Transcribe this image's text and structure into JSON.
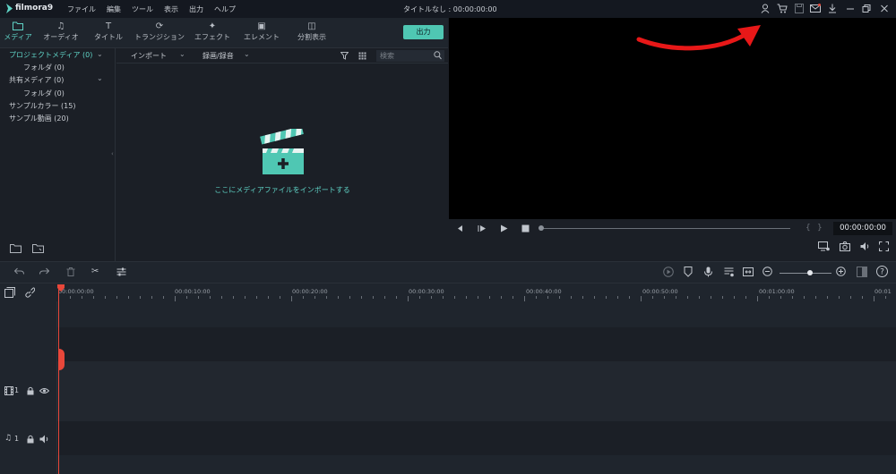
{
  "app": {
    "logo_text": "filmora9",
    "title": "タイトルなし : 00:00:00:00"
  },
  "menu": [
    "ファイル",
    "編集",
    "ツール",
    "表示",
    "出力",
    "ヘルプ"
  ],
  "toolbar": {
    "tabs": [
      {
        "label": "メディア",
        "icon": "folder-icon",
        "active": true
      },
      {
        "label": "オーディオ",
        "icon": "music-note-icon",
        "active": false
      },
      {
        "label": "タイトル",
        "icon": "title-icon",
        "active": false
      },
      {
        "label": "トランジション",
        "icon": "transition-icon",
        "active": false
      },
      {
        "label": "エフェクト",
        "icon": "effect-icon",
        "active": false
      },
      {
        "label": "エレメント",
        "icon": "element-icon",
        "active": false
      },
      {
        "label": "分割表示",
        "icon": "split-screen-icon",
        "active": false
      }
    ],
    "export_label": "出力"
  },
  "sidebar": {
    "items": [
      {
        "label": "プロジェクトメディア (0)"
      },
      {
        "label": "フォルダ (0)"
      },
      {
        "label": "共有メディア (0)"
      },
      {
        "label": "フォルダ (0)"
      },
      {
        "label": "サンプルカラー (15)"
      },
      {
        "label": "サンプル動画 (20)"
      }
    ]
  },
  "media": {
    "import_label": "インポート",
    "record_label": "録画/録音",
    "search_placeholder": "検索",
    "empty_hint": "ここにメディアファイルをインポートする"
  },
  "preview": {
    "timecode": "00:00:00:00"
  },
  "ruler": {
    "labels": [
      "00:00:00:00",
      "00:00:10:00",
      "00:00:20:00",
      "00:00:30:00",
      "00:00:40:00",
      "00:00:50:00",
      "00:01:00:00",
      "00:01"
    ]
  },
  "tracks": {
    "video_label": "1",
    "audio_label": "1"
  },
  "colors": {
    "accent": "#4fc7b3",
    "playhead": "#e8473a",
    "arrow": "#e81818"
  }
}
